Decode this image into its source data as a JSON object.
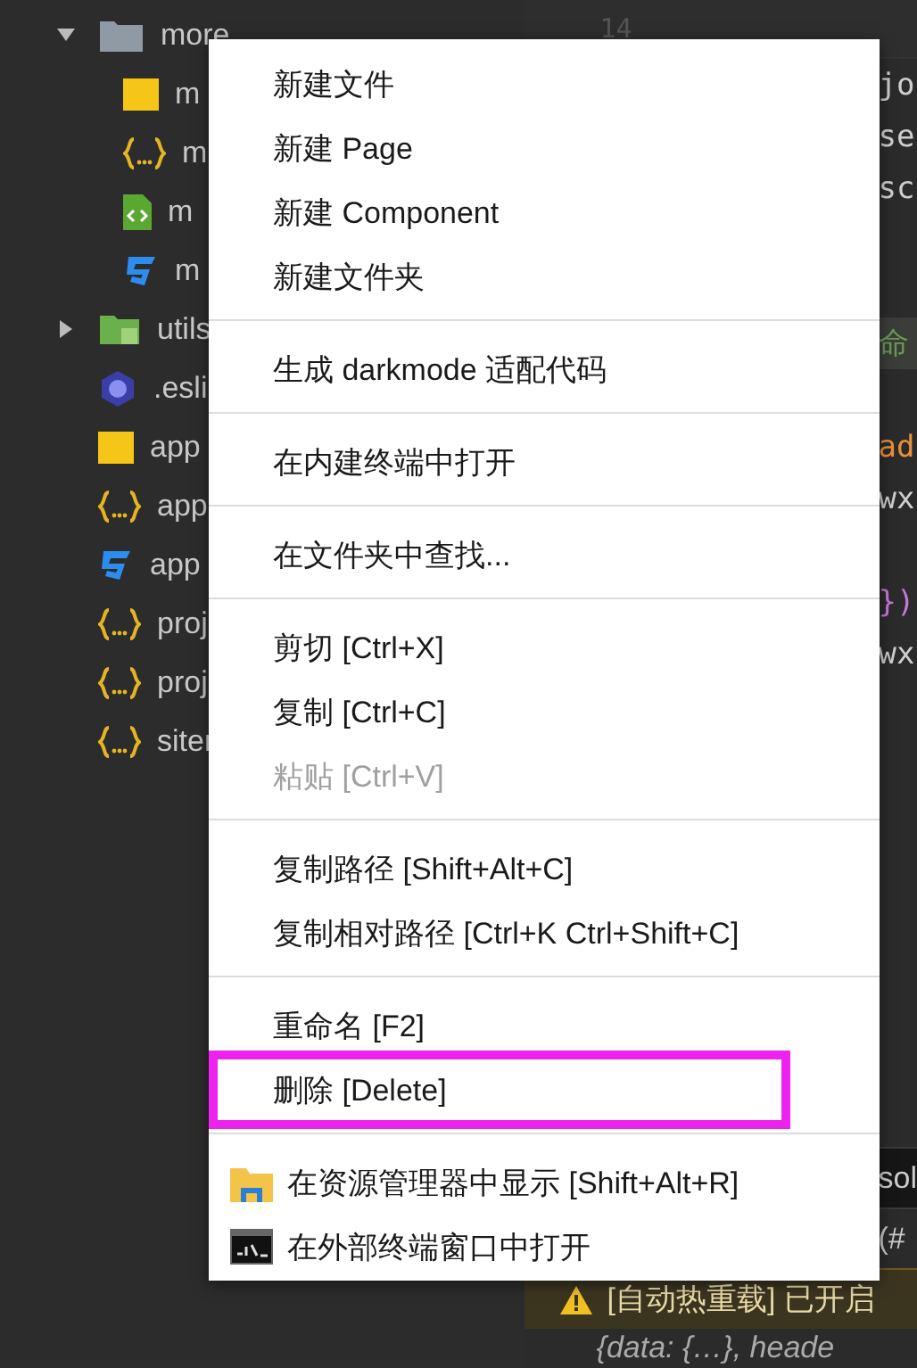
{
  "editor": {
    "line_number": "14",
    "code_lines": [
      {
        "text": "jo",
        "kind": "plain"
      },
      {
        "text": "se",
        "kind": "plain"
      },
      {
        "text": "sc",
        "kind": "plain"
      },
      {
        "kind": "blank"
      },
      {
        "kind": "blank"
      },
      {
        "text": "命",
        "kind": "comment"
      },
      {
        "kind": "blank"
      },
      {
        "text": "ad",
        "kind": "keyword"
      },
      {
        "text": "wx",
        "kind": "plain"
      },
      {
        "kind": "blank"
      },
      {
        "text": "})",
        "kind": "brace"
      },
      {
        "text": "wx",
        "kind": "plain"
      }
    ]
  },
  "file_tree": [
    {
      "label": "more",
      "kind": "folder",
      "expanded": true,
      "children": [
        {
          "label": "m",
          "kind": "js"
        },
        {
          "label": "m",
          "kind": "json"
        },
        {
          "label": "m",
          "kind": "wxml"
        },
        {
          "label": "m",
          "kind": "css"
        }
      ]
    },
    {
      "label": "utils",
      "kind": "package",
      "expanded": false
    },
    {
      "label": ".esli",
      "kind": "eslint"
    },
    {
      "label": "app",
      "kind": "js"
    },
    {
      "label": "app",
      "kind": "json"
    },
    {
      "label": "app",
      "kind": "css"
    },
    {
      "label": "proj",
      "kind": "json"
    },
    {
      "label": "proj",
      "kind": "json"
    },
    {
      "label": "siter",
      "kind": "json"
    }
  ],
  "console": {
    "line_1": "sol",
    "line_2": "(#",
    "warning": "[自动热重载] 已开启",
    "object": "{data: {…}, heade"
  },
  "context_menu": [
    {
      "kind": "item",
      "label": "新建文件",
      "disabled": false
    },
    {
      "kind": "item",
      "label": "新建 Page",
      "disabled": false
    },
    {
      "kind": "item",
      "label": "新建 Component",
      "disabled": false
    },
    {
      "kind": "item",
      "label": "新建文件夹",
      "disabled": false
    },
    {
      "kind": "separator"
    },
    {
      "kind": "item",
      "label": "生成 darkmode 适配代码",
      "disabled": false
    },
    {
      "kind": "separator"
    },
    {
      "kind": "item",
      "label": "在内建终端中打开",
      "disabled": false
    },
    {
      "kind": "separator"
    },
    {
      "kind": "item",
      "label": "在文件夹中查找...",
      "disabled": false
    },
    {
      "kind": "separator"
    },
    {
      "kind": "item",
      "label": "剪切  [Ctrl+X]",
      "disabled": false
    },
    {
      "kind": "item",
      "label": "复制  [Ctrl+C]",
      "disabled": false
    },
    {
      "kind": "item",
      "label": "粘贴  [Ctrl+V]",
      "disabled": true
    },
    {
      "kind": "separator"
    },
    {
      "kind": "item",
      "label": "复制路径  [Shift+Alt+C]",
      "disabled": false
    },
    {
      "kind": "item",
      "label": "复制相对路径  [Ctrl+K Ctrl+Shift+C]",
      "disabled": false
    },
    {
      "kind": "separator"
    },
    {
      "kind": "item",
      "label": "重命名  [F2]",
      "disabled": false
    },
    {
      "kind": "item",
      "label": "删除  [Delete]",
      "disabled": false,
      "highlighted": true
    },
    {
      "kind": "separator"
    },
    {
      "kind": "explorer",
      "label": "在资源管理器中显示  [Shift+Alt+R]",
      "disabled": false
    },
    {
      "kind": "terminal",
      "label": "在外部终端窗口中打开",
      "disabled": false
    }
  ]
}
